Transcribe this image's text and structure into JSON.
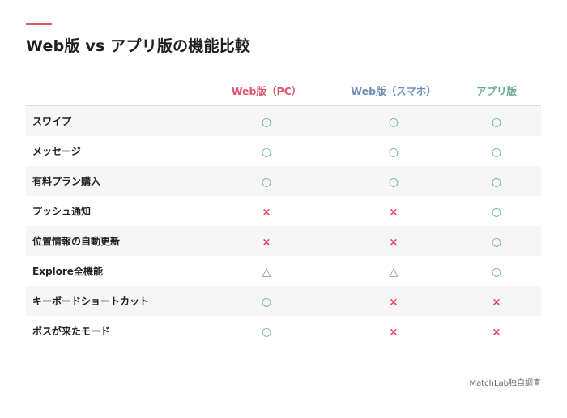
{
  "title": "Web版 vs アプリ版の機能比較",
  "columns": [
    "Web版（PC）",
    "Web版（スマホ）",
    "アプリ版"
  ],
  "colors": {
    "accent": "#e0566f",
    "pc": "#e0566f",
    "smartphone": "#6e8fb5",
    "app": "#6aa98c",
    "ok": "#5aa97f",
    "ng": "#e23b4f"
  },
  "rows": [
    {
      "feature": "スワイプ",
      "values": [
        "○",
        "○",
        "○"
      ]
    },
    {
      "feature": "メッセージ",
      "values": [
        "○",
        "○",
        "○"
      ]
    },
    {
      "feature": "有料プラン購入",
      "values": [
        "○",
        "○",
        "○"
      ]
    },
    {
      "feature": "プッシュ通知",
      "values": [
        "×",
        "×",
        "○"
      ]
    },
    {
      "feature": "位置情報の自動更新",
      "values": [
        "×",
        "×",
        "○"
      ]
    },
    {
      "feature": "Explore全機能",
      "values": [
        "△",
        "△",
        "○"
      ]
    },
    {
      "feature": "キーボードショートカット",
      "values": [
        "○",
        "×",
        "×"
      ]
    },
    {
      "feature": "ボスが来たモード",
      "values": [
        "○",
        "×",
        "×"
      ]
    }
  ],
  "source": "MatchLab独自調査"
}
